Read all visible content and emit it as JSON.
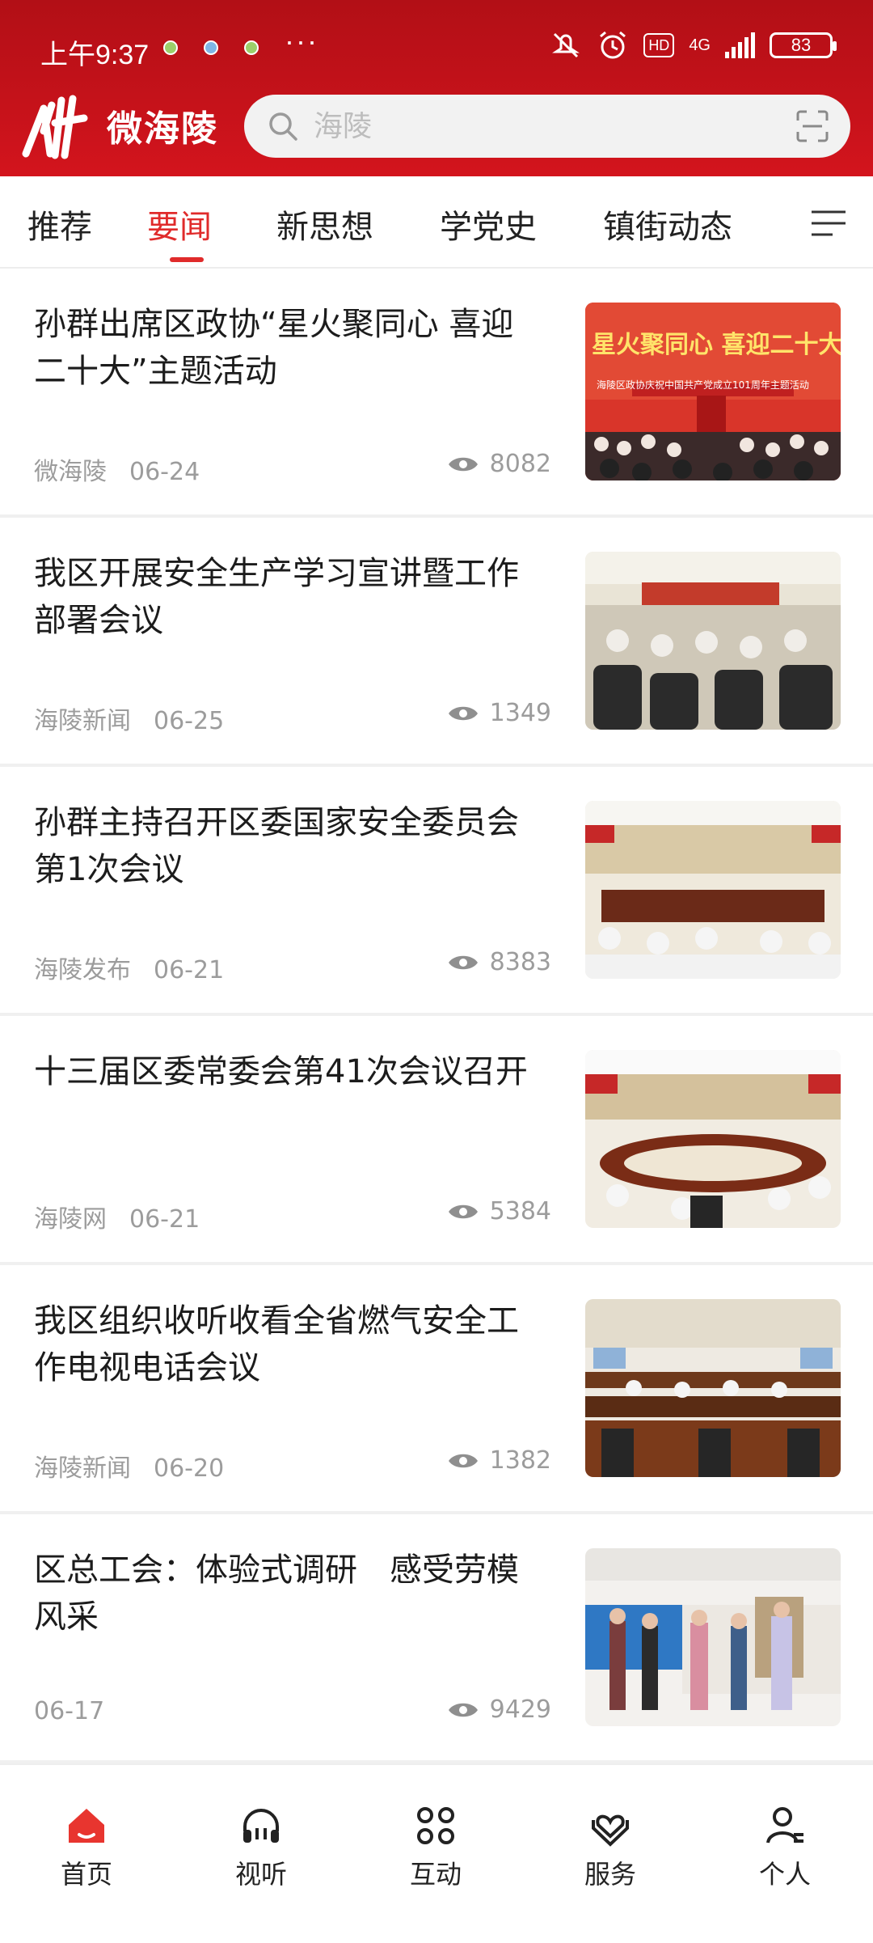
{
  "status": {
    "time": "上午9:37",
    "more": "···",
    "hd": "HD",
    "network": "4G",
    "battery": "83"
  },
  "brand": {
    "name": "微海陵"
  },
  "search": {
    "placeholder": "海陵"
  },
  "tabs": [
    {
      "label": "推荐"
    },
    {
      "label": "要闻",
      "active": true
    },
    {
      "label": "新思想"
    },
    {
      "label": "学党史"
    },
    {
      "label": "镇街动态"
    }
  ],
  "news": [
    {
      "title": "孙群出席区政协“星火聚同心 喜迎二十大”主题活动",
      "source": "微海陵",
      "date": "06-24",
      "views": "8082",
      "thumb_banner_line1": "星火聚同心 喜迎二十大",
      "thumb_banner_line2": "海陵区政协庆祝中国共产党成立101周年主题活动"
    },
    {
      "title": "我区开展安全生产学习宣讲暨工作部署会议",
      "source": "海陵新闻",
      "date": "06-25",
      "views": "1349"
    },
    {
      "title": "孙群主持召开区委国家安全委员会第1次会议",
      "source": "海陵发布",
      "date": "06-21",
      "views": "8383"
    },
    {
      "title": "十三届区委常委会第41次会议召开",
      "source": "海陵网",
      "date": "06-21",
      "views": "5384"
    },
    {
      "title": "我区组织收听收看全省燃气安全工作电视电话会议",
      "source": "海陵新闻",
      "date": "06-20",
      "views": "1382"
    },
    {
      "title": "区总工会：体验式调研　感受劳模风采",
      "source": "",
      "date": "06-17",
      "views": "9429"
    }
  ],
  "bottom_nav": [
    {
      "label": "首页",
      "icon": "home-icon",
      "active": true
    },
    {
      "label": "视听",
      "icon": "headphones-icon"
    },
    {
      "label": "互动",
      "icon": "grid-icon"
    },
    {
      "label": "服务",
      "icon": "heart-hands-icon"
    },
    {
      "label": "个人",
      "icon": "user-icon"
    }
  ],
  "colors": {
    "brand_red": "#d3141d",
    "accent": "#e02b2b",
    "nav_active": "#e8352f"
  }
}
